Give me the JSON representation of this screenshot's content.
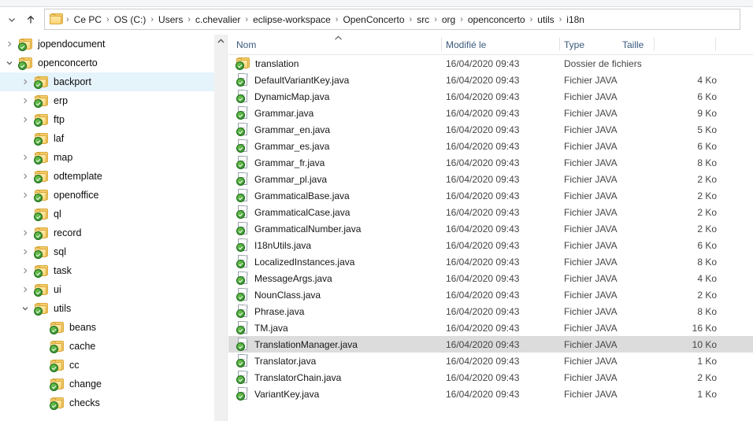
{
  "window": {
    "title": "i18n"
  },
  "toolbar": {
    "recent_locations_icon": "chevron-down-icon",
    "up_icon": "arrow-up-icon"
  },
  "address_bar": {
    "folder_icon": "folder-icon",
    "separator": "›",
    "crumbs": [
      "Ce PC",
      "OS (C:)",
      "Users",
      "c.chevalier",
      "eclipse-workspace",
      "OpenConcerto",
      "src",
      "org",
      "openconcerto",
      "utils",
      "i18n"
    ]
  },
  "nav_pane": {
    "scrollbar_up_icon": "scroll-up-arrow-icon",
    "items": [
      {
        "label": "jopendocument",
        "indent": 1,
        "twisty": "collapsed",
        "selected": false
      },
      {
        "label": "openconcerto",
        "indent": 1,
        "twisty": "expanded",
        "selected": false
      },
      {
        "label": "backport",
        "indent": 2,
        "twisty": "collapsed",
        "selected": true
      },
      {
        "label": "erp",
        "indent": 2,
        "twisty": "collapsed",
        "selected": false
      },
      {
        "label": "ftp",
        "indent": 2,
        "twisty": "collapsed",
        "selected": false
      },
      {
        "label": "laf",
        "indent": 2,
        "twisty": "none",
        "selected": false
      },
      {
        "label": "map",
        "indent": 2,
        "twisty": "collapsed",
        "selected": false
      },
      {
        "label": "odtemplate",
        "indent": 2,
        "twisty": "collapsed",
        "selected": false
      },
      {
        "label": "openoffice",
        "indent": 2,
        "twisty": "collapsed",
        "selected": false
      },
      {
        "label": "ql",
        "indent": 2,
        "twisty": "none",
        "selected": false
      },
      {
        "label": "record",
        "indent": 2,
        "twisty": "collapsed",
        "selected": false
      },
      {
        "label": "sql",
        "indent": 2,
        "twisty": "collapsed",
        "selected": false
      },
      {
        "label": "task",
        "indent": 2,
        "twisty": "collapsed",
        "selected": false
      },
      {
        "label": "ui",
        "indent": 2,
        "twisty": "collapsed",
        "selected": false
      },
      {
        "label": "utils",
        "indent": 2,
        "twisty": "expanded",
        "selected": false
      },
      {
        "label": "beans",
        "indent": 3,
        "twisty": "none",
        "selected": false
      },
      {
        "label": "cache",
        "indent": 3,
        "twisty": "none",
        "selected": false
      },
      {
        "label": "cc",
        "indent": 3,
        "twisty": "none",
        "selected": false
      },
      {
        "label": "change",
        "indent": 3,
        "twisty": "none",
        "selected": false
      },
      {
        "label": "checks",
        "indent": 3,
        "twisty": "none",
        "selected": false
      }
    ]
  },
  "file_list": {
    "columns": [
      {
        "key": "name",
        "label": "Nom",
        "sorted": "asc"
      },
      {
        "key": "modified",
        "label": "Modifié le",
        "sorted": ""
      },
      {
        "key": "type",
        "label": "Type",
        "sorted": ""
      },
      {
        "key": "size",
        "label": "Taille",
        "sorted": ""
      }
    ],
    "rows": [
      {
        "name": "translation",
        "modified": "16/04/2020 09:43",
        "type": "Dossier de fichiers",
        "size": "",
        "kind": "folder",
        "selected": false
      },
      {
        "name": "DefaultVariantKey.java",
        "modified": "16/04/2020 09:43",
        "type": "Fichier JAVA",
        "size": "4 Ko",
        "kind": "file",
        "selected": false
      },
      {
        "name": "DynamicMap.java",
        "modified": "16/04/2020 09:43",
        "type": "Fichier JAVA",
        "size": "6 Ko",
        "kind": "file",
        "selected": false
      },
      {
        "name": "Grammar.java",
        "modified": "16/04/2020 09:43",
        "type": "Fichier JAVA",
        "size": "9 Ko",
        "kind": "file",
        "selected": false
      },
      {
        "name": "Grammar_en.java",
        "modified": "16/04/2020 09:43",
        "type": "Fichier JAVA",
        "size": "5 Ko",
        "kind": "file",
        "selected": false
      },
      {
        "name": "Grammar_es.java",
        "modified": "16/04/2020 09:43",
        "type": "Fichier JAVA",
        "size": "6 Ko",
        "kind": "file",
        "selected": false
      },
      {
        "name": "Grammar_fr.java",
        "modified": "16/04/2020 09:43",
        "type": "Fichier JAVA",
        "size": "8 Ko",
        "kind": "file",
        "selected": false
      },
      {
        "name": "Grammar_pl.java",
        "modified": "16/04/2020 09:43",
        "type": "Fichier JAVA",
        "size": "2 Ko",
        "kind": "file",
        "selected": false
      },
      {
        "name": "GrammaticalBase.java",
        "modified": "16/04/2020 09:43",
        "type": "Fichier JAVA",
        "size": "2 Ko",
        "kind": "file",
        "selected": false
      },
      {
        "name": "GrammaticalCase.java",
        "modified": "16/04/2020 09:43",
        "type": "Fichier JAVA",
        "size": "2 Ko",
        "kind": "file",
        "selected": false
      },
      {
        "name": "GrammaticalNumber.java",
        "modified": "16/04/2020 09:43",
        "type": "Fichier JAVA",
        "size": "2 Ko",
        "kind": "file",
        "selected": false
      },
      {
        "name": "I18nUtils.java",
        "modified": "16/04/2020 09:43",
        "type": "Fichier JAVA",
        "size": "6 Ko",
        "kind": "file",
        "selected": false
      },
      {
        "name": "LocalizedInstances.java",
        "modified": "16/04/2020 09:43",
        "type": "Fichier JAVA",
        "size": "8 Ko",
        "kind": "file",
        "selected": false
      },
      {
        "name": "MessageArgs.java",
        "modified": "16/04/2020 09:43",
        "type": "Fichier JAVA",
        "size": "4 Ko",
        "kind": "file",
        "selected": false
      },
      {
        "name": "NounClass.java",
        "modified": "16/04/2020 09:43",
        "type": "Fichier JAVA",
        "size": "2 Ko",
        "kind": "file",
        "selected": false
      },
      {
        "name": "Phrase.java",
        "modified": "16/04/2020 09:43",
        "type": "Fichier JAVA",
        "size": "8 Ko",
        "kind": "file",
        "selected": false
      },
      {
        "name": "TM.java",
        "modified": "16/04/2020 09:43",
        "type": "Fichier JAVA",
        "size": "16 Ko",
        "kind": "file",
        "selected": false
      },
      {
        "name": "TranslationManager.java",
        "modified": "16/04/2020 09:43",
        "type": "Fichier JAVA",
        "size": "10 Ko",
        "kind": "file",
        "selected": true
      },
      {
        "name": "Translator.java",
        "modified": "16/04/2020 09:43",
        "type": "Fichier JAVA",
        "size": "1 Ko",
        "kind": "file",
        "selected": false
      },
      {
        "name": "TranslatorChain.java",
        "modified": "16/04/2020 09:43",
        "type": "Fichier JAVA",
        "size": "2 Ko",
        "kind": "file",
        "selected": false
      },
      {
        "name": "VariantKey.java",
        "modified": "16/04/2020 09:43",
        "type": "Fichier JAVA",
        "size": "1 Ko",
        "kind": "file",
        "selected": false
      }
    ]
  },
  "colors": {
    "selection_nav": "#e5f3fb",
    "selection_list": "#dcdcdc",
    "header_text": "#3a5a7d",
    "folder": "#f5cd6a",
    "sync_badge": "#2e8b2e"
  }
}
